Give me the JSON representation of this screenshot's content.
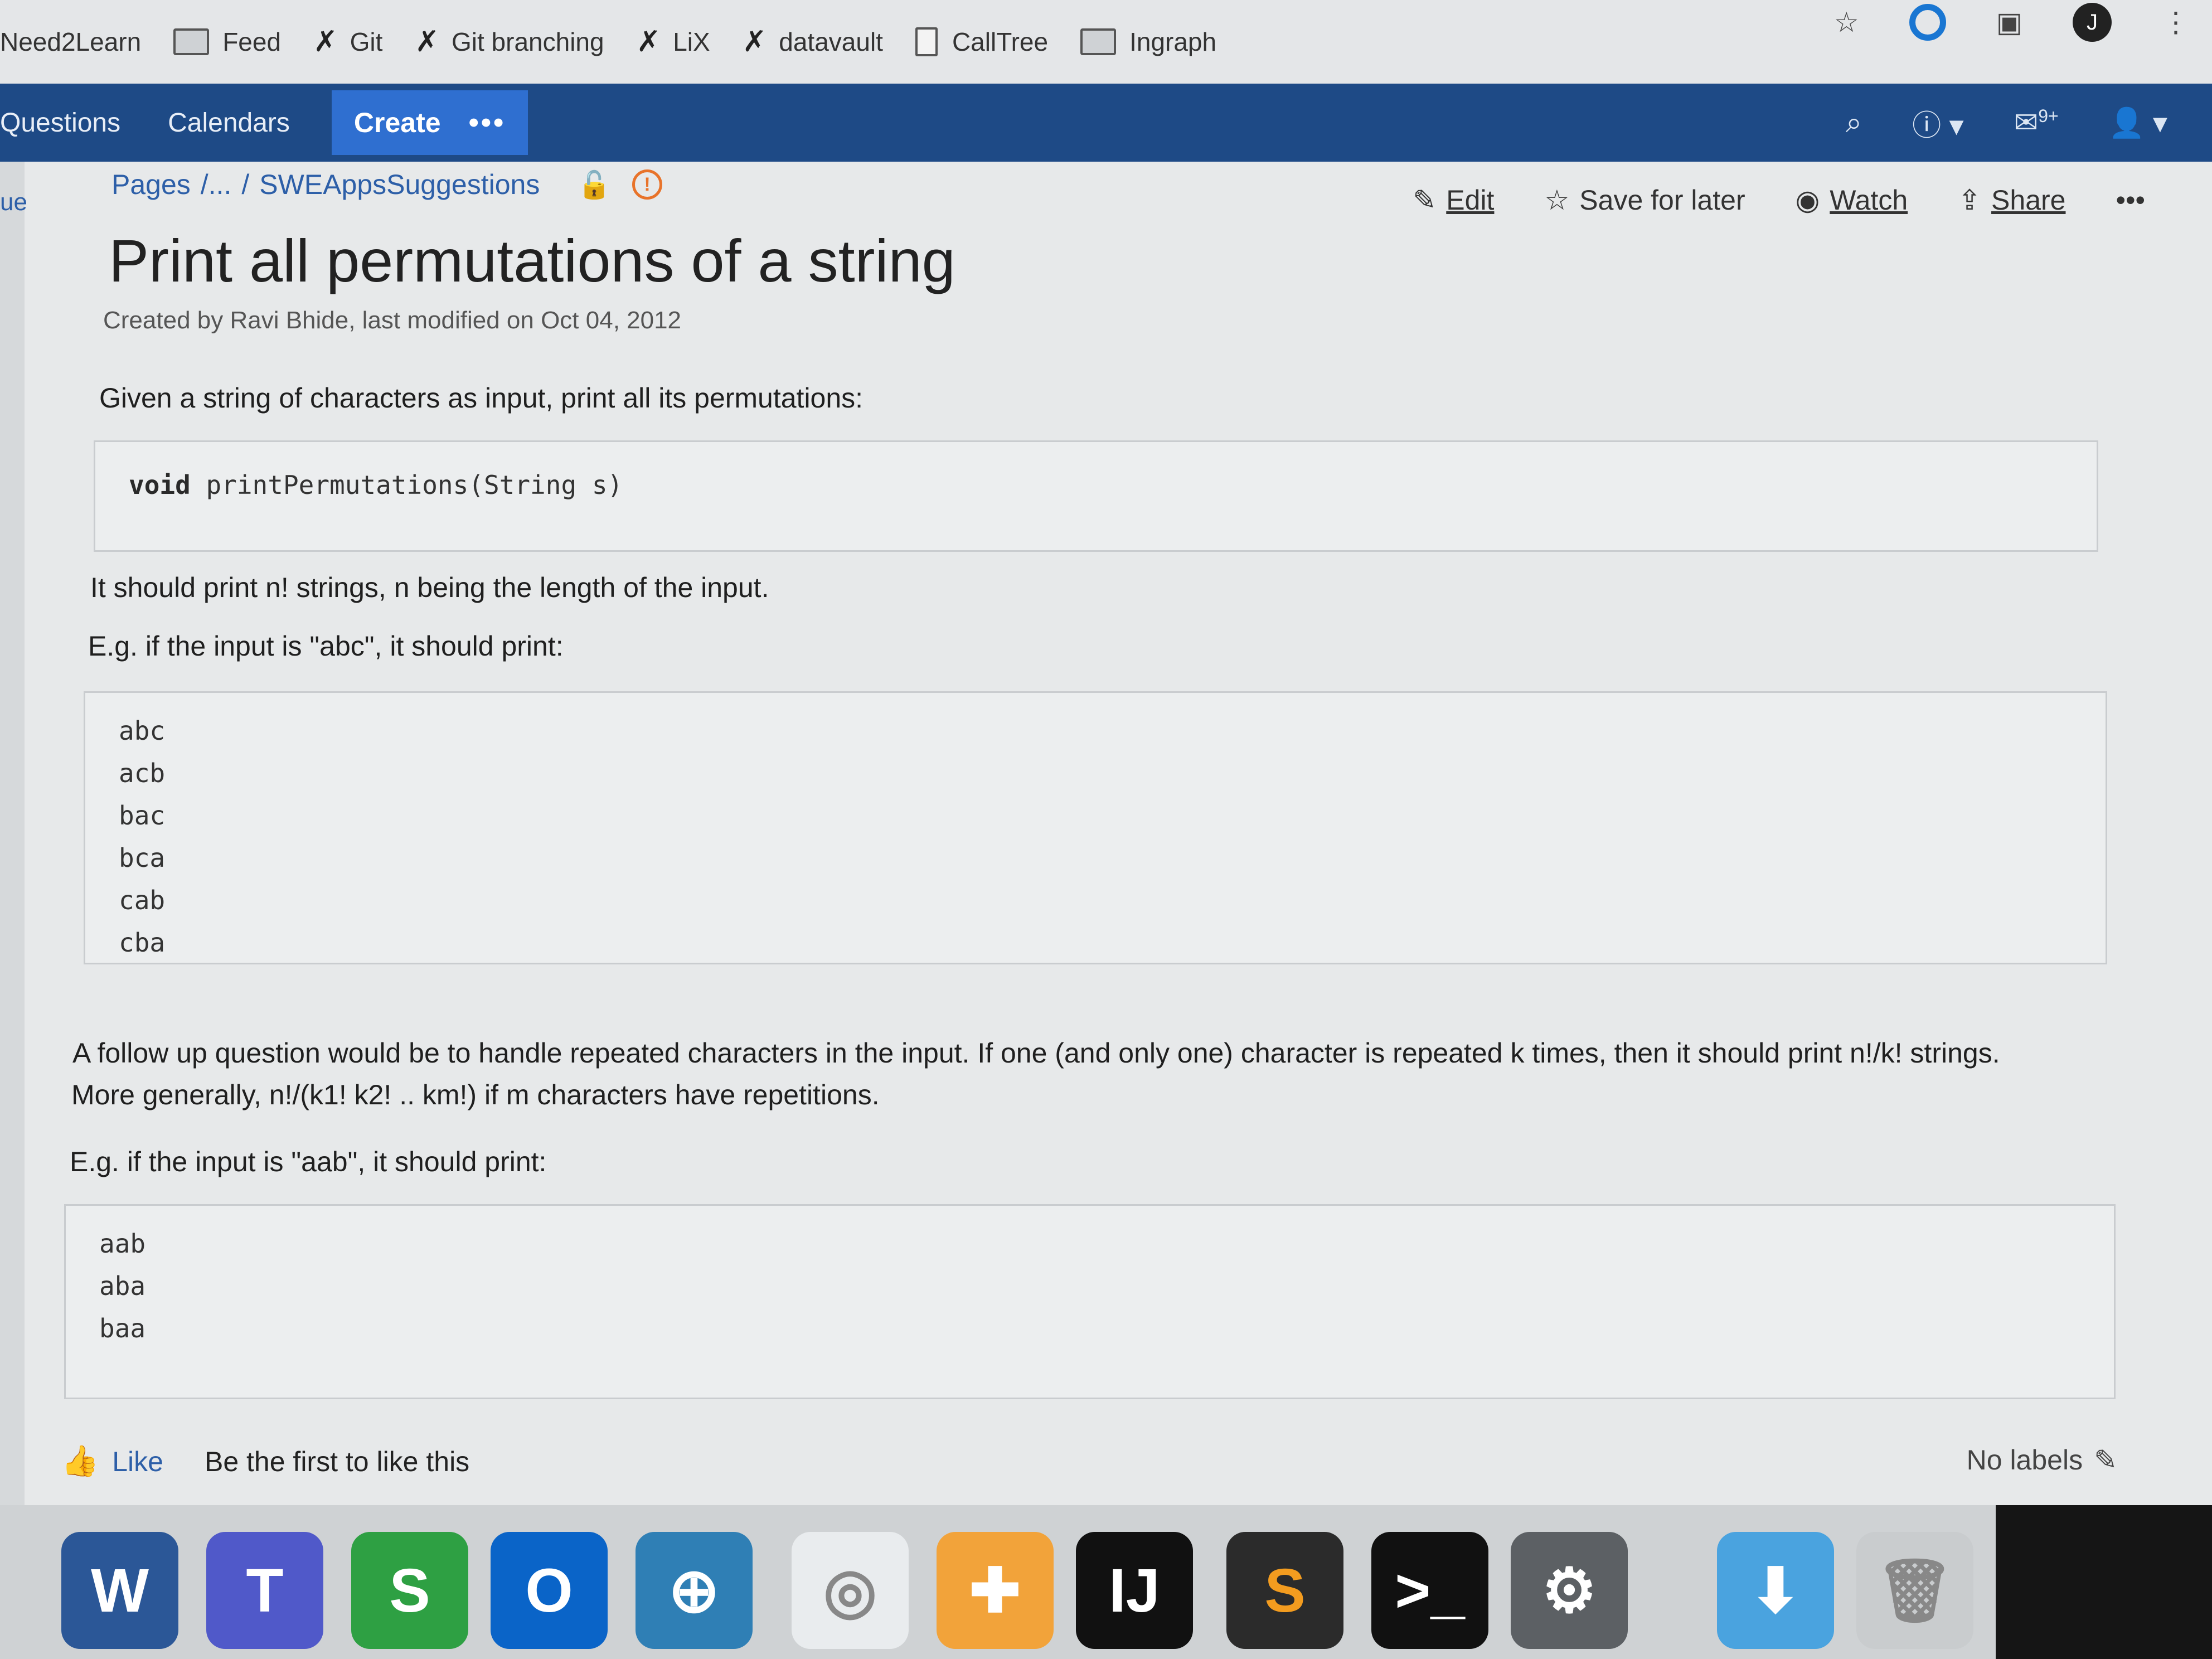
{
  "bookmarks": [
    {
      "label": "Need2Learn",
      "icon": "none"
    },
    {
      "label": "Feed",
      "icon": "folder-icon"
    },
    {
      "label": "Git",
      "icon": "x-icon"
    },
    {
      "label": "Git branching",
      "icon": "x-icon"
    },
    {
      "label": "LiX",
      "icon": "x-icon"
    },
    {
      "label": "datavault",
      "icon": "x-icon"
    },
    {
      "label": "CallTree",
      "icon": "page-icon"
    },
    {
      "label": "Ingraph",
      "icon": "folder-icon"
    }
  ],
  "browser": {
    "avatar_letter": "J"
  },
  "nav": {
    "questions": "Questions",
    "calendars": "Calendars",
    "create": "Create",
    "more": "•••",
    "notifications_badge": "9+"
  },
  "sidebar": {
    "fragment": "ue"
  },
  "breadcrumb": {
    "root": "Pages",
    "sep1": "/...",
    "sep2": "/",
    "page": "SWEAppsSuggestions",
    "warn": "!"
  },
  "actions": {
    "edit": "Edit",
    "save": "Save for later",
    "watch": "Watch",
    "share": "Share",
    "more": "•••"
  },
  "page": {
    "title": "Print all permutations of a string",
    "byline": "Created by Ravi Bhide, last modified on Oct 04, 2012",
    "intro": "Given a string of characters as input, print all its permutations:",
    "signature_kw": "void",
    "signature_rest": " printPermutations(String s)",
    "p2": "It should print n! strings, n being the length of the input.",
    "p3": "E.g. if the input is \"abc\", it should print:",
    "example1": [
      "abc",
      "acb",
      "bac",
      "bca",
      "cab",
      "cba"
    ],
    "p4a": "A follow up question would be to handle repeated characters in the input. If one (and only one) character is repeated k times, then it should print n!/k! strings.",
    "p4b": "More generally, n!/(k1! k2! .. km!) if m characters have repetitions.",
    "p5": "E.g. if the input is \"aab\", it should print:",
    "example2": [
      "aab",
      "aba",
      "baa"
    ]
  },
  "footer": {
    "like": "Like",
    "first": "Be the first to like this",
    "labels": "No labels"
  },
  "dock": [
    {
      "name": "word-icon",
      "glyph": "W",
      "color": "#2b5797"
    },
    {
      "name": "teams-icon",
      "glyph": "T",
      "color": "#5059c9"
    },
    {
      "name": "skype-icon",
      "glyph": "S",
      "color": "#2ea043"
    },
    {
      "name": "outlook-icon",
      "glyph": "O",
      "color": "#0a64c8"
    },
    {
      "name": "vpn-icon",
      "glyph": "⊕",
      "color": "#2f7fb5"
    },
    {
      "name": "wifi-icon",
      "glyph": "◎",
      "color": "#e9ecee"
    },
    {
      "name": "self-service-icon",
      "glyph": "✚",
      "color": "#f2a33a"
    },
    {
      "name": "intellij-icon",
      "glyph": "IJ",
      "color": "#111111"
    },
    {
      "name": "sublime-icon",
      "glyph": "S",
      "color": "#2b2b2b"
    },
    {
      "name": "terminal-icon",
      "glyph": ">_",
      "color": "#111111"
    },
    {
      "name": "system-preferences-icon",
      "glyph": "⚙",
      "color": "#5c6064"
    },
    {
      "name": "downloads-folder-icon",
      "glyph": "⬇",
      "color": "#4aa3df"
    },
    {
      "name": "trash-icon",
      "glyph": "🗑",
      "color": "#c9ccce"
    }
  ]
}
